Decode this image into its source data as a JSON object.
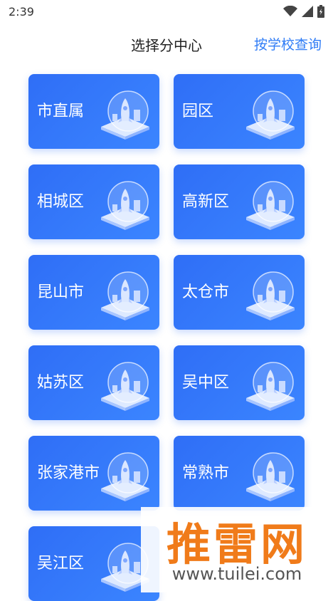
{
  "status": {
    "time": "2:39"
  },
  "header": {
    "title": "选择分中心",
    "search_link": "按学校查询"
  },
  "centers": [
    "市直属",
    "园区",
    "相城区",
    "高新区",
    "昆山市",
    "太仓市",
    "姑苏区",
    "吴中区",
    "张家港市",
    "常熟市",
    "吴江区"
  ],
  "watermark": {
    "logo": "推雷网",
    "url": "www.tuilei.com"
  },
  "colors": {
    "accent": "#2f7cf6",
    "card": "#3b82f6",
    "watermark": "#f07b1a"
  }
}
